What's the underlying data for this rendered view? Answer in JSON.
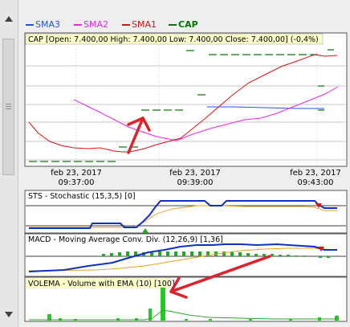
{
  "legend": [
    {
      "name": "SMA3",
      "color": "#2255dd"
    },
    {
      "name": "SMA2",
      "color": "#ee22ee"
    },
    {
      "name": "SMA1",
      "color": "#dd1111"
    },
    {
      "name": "CAP",
      "color": "#007700"
    }
  ],
  "main_chart": {
    "title": "CAP [Open: 7.400,00  High: 7.400,00  Low: 7.400,00  Close: 7.400,00] (-0,4%)",
    "x_ticks": [
      {
        "date": "feb 23, 2017",
        "time": "09:37:00"
      },
      {
        "date": "feb 23, 2017",
        "time": "09:39:00"
      },
      {
        "date": "feb 23, 2017",
        "time": "09:43:00"
      }
    ]
  },
  "indicators": {
    "sts": "STS - Stochastic (15,3,5) [0]",
    "macd": "MACD - Moving Average Conv. Div. (12,26,9) [1,36]",
    "volema": "VOLEMA - Volume with EMA (10) [100]"
  },
  "colors": {
    "annotation_arrow": "#e0202a",
    "highlight": "#ffff00"
  }
}
